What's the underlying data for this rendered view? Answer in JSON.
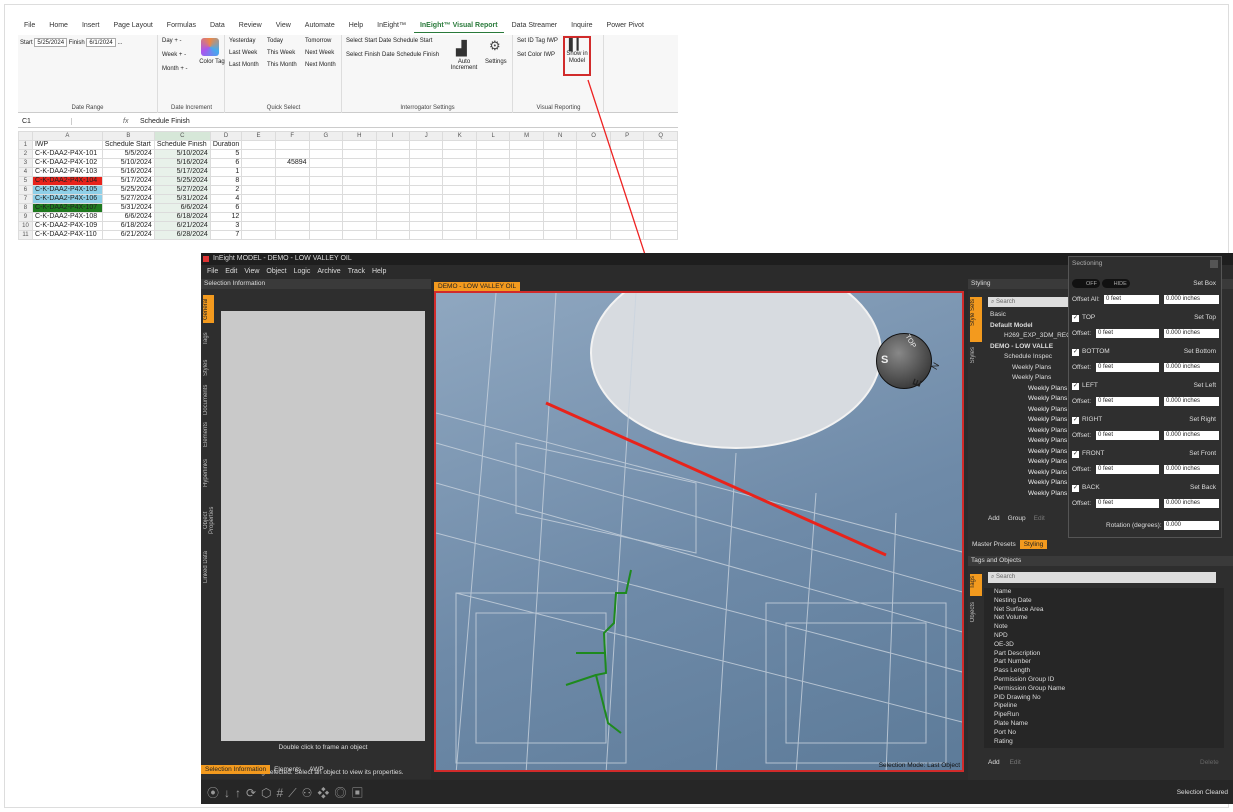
{
  "excel": {
    "menu": [
      "File",
      "Home",
      "Insert",
      "Page Layout",
      "Formulas",
      "Data",
      "Review",
      "View",
      "Automate",
      "Help",
      "InEight™",
      "InEight™ Visual Report",
      "Data Streamer",
      "Inquire",
      "Power Pivot"
    ],
    "active_menu": "InEight™ Visual Report",
    "ribbon": {
      "start_label": "Start",
      "start_value": "5/25/2024",
      "finish_label": "Finish",
      "finish_value": "6/1/2024",
      "dots": "...",
      "date_range_title": "Date Range",
      "day": "Day + -",
      "week": "Week + -",
      "month": "Month + -",
      "color_tag": "Color Tag",
      "date_increment_title": "Date Increment",
      "quick": [
        "Yesterday",
        "Today",
        "Tomorrow",
        "Last Week",
        "This Week",
        "Next Week",
        "Last Month",
        "This Month",
        "Next Month"
      ],
      "quick_select_title": "Quick Select",
      "sel_start_date": "Select Start Date",
      "sched_start": "Schedule Start",
      "sel_finish_date": "Select Finish Date",
      "sched_finish": "Schedule Finish",
      "auto_increment": "Auto Increment",
      "settings": "Settings",
      "interrogator_title": "Interrogator Settings",
      "set_id_tag": "Set ID Tag",
      "iwp1": "IWP",
      "set_color": "Set Color",
      "iwp2": "IWP",
      "show_in_model": "Show in Model",
      "visual_reporting_title": "Visual Reporting"
    },
    "formula": {
      "cell": "C1",
      "fx": "fx",
      "content": "Schedule Finish"
    },
    "col_headers": [
      "A",
      "B",
      "C",
      "D",
      "E",
      "F",
      "G",
      "H",
      "I",
      "J",
      "K",
      "L",
      "M",
      "N",
      "O",
      "P",
      "Q"
    ],
    "rows": [
      [
        "IWP",
        "Schedule Start",
        "Schedule Finish",
        "Duration",
        ""
      ],
      [
        "C-K-DAA2-P4X-101",
        "5/5/2024",
        "5/10/2024",
        "5",
        ""
      ],
      [
        "C-K-DAA2-P4X-102",
        "5/10/2024",
        "5/16/2024",
        "6",
        "45894"
      ],
      [
        "C-K-DAA2-P4X-103",
        "5/16/2024",
        "5/17/2024",
        "1",
        ""
      ],
      [
        "C-K-DAA2-P4X-104",
        "5/17/2024",
        "5/25/2024",
        "8",
        ""
      ],
      [
        "C-K-DAA2-P4X-105",
        "5/25/2024",
        "5/27/2024",
        "2",
        ""
      ],
      [
        "C-K-DAA2-P4X-106",
        "5/27/2024",
        "5/31/2024",
        "4",
        ""
      ],
      [
        "C-K-DAA2-P4X-107",
        "5/31/2024",
        "6/6/2024",
        "6",
        ""
      ],
      [
        "C-K-DAA2-P4X-108",
        "6/6/2024",
        "6/18/2024",
        "12",
        ""
      ],
      [
        "C-K-DAA2-P4X-109",
        "6/18/2024",
        "6/21/2024",
        "3",
        ""
      ],
      [
        "C-K-DAA2-P4X-110",
        "6/21/2024",
        "6/28/2024",
        "7",
        ""
      ]
    ],
    "row_colors": {
      "5": "#e8231b",
      "6": "#8fd0e8",
      "7": "#8fd0e8",
      "8": "#1f7a1f"
    }
  },
  "app": {
    "title": "InEight MODEL - DEMO - LOW VALLEY OIL",
    "menu": [
      "File",
      "Edit",
      "View",
      "Object",
      "Logic",
      "Archive",
      "Track",
      "Help"
    ],
    "selection_info": "Selection Information",
    "vtabs": [
      "General",
      "Tags",
      "Styles",
      "Documents",
      "Elements",
      "Hyperlinks",
      "Object Properties",
      "Linked Data"
    ],
    "double_click": "Double click to frame an object",
    "nothing_selected": "Nothing selected. Select an object to view its properties.",
    "bottom_tabs": [
      "Selection Information",
      "Elements",
      "AWP"
    ],
    "viewport_tab": "DEMO - LOW VALLEY OIL",
    "selection_mode": "Selection Mode: Last Object",
    "status": "Selection Cleared",
    "styling": {
      "title": "Styling",
      "search": "Search",
      "vtabs": [
        "Style Sets",
        "Styles"
      ],
      "items": [
        "Basic",
        "Default Model",
        "H269_EXP_3DM_REC",
        "DEMO - LOW VALLE",
        "Schedule Inspec",
        "Weekly Plans",
        "Weekly Plans",
        "Weekly Plans",
        "Weekly Plans",
        "Weekly Plans",
        "Weekly Plans",
        "Weekly Plans",
        "Weekly Plans",
        "Weekly Plans",
        "Weekly Plans",
        "Weekly Plans",
        "Weekly Plans",
        "Weekly Plans"
      ],
      "add": "Add",
      "group": "Group",
      "edit": "Edit",
      "tabs": [
        "Master Presets",
        "Styling"
      ]
    },
    "tags": {
      "title": "Tags and Objects",
      "search": "Search",
      "vtabs": [
        "Tags",
        "Objects"
      ],
      "items": [
        "Name",
        "Nesting Date",
        "Net Surface Area",
        "Net Volume",
        "Note",
        "NPD",
        "OE-3D",
        "Part Description",
        "Part Number",
        "Pass Length",
        "Permission Group ID",
        "Permission Group Name",
        "PID Drawing No",
        "Pipeline",
        "PipeRun",
        "Plate Name",
        "Port No",
        "Rating"
      ],
      "add": "Add",
      "edit": "Edit",
      "delete": "Delete"
    },
    "sectioning": {
      "title": "Sectioning",
      "off": "OFF",
      "hide": "HIDE",
      "set_box": "Set Box",
      "offset_all": "Offset All:",
      "feet": "0 feet",
      "inches": "0.000 inches",
      "sides": [
        {
          "name": "TOP",
          "btn": "Set Top"
        },
        {
          "name": "BOTTOM",
          "btn": "Set Bottom"
        },
        {
          "name": "LEFT",
          "btn": "Set Left"
        },
        {
          "name": "RIGHT",
          "btn": "Set Right"
        },
        {
          "name": "FRONT",
          "btn": "Set Front"
        },
        {
          "name": "BACK",
          "btn": "Set Back"
        }
      ],
      "offset": "Offset:",
      "rotation_label": "Rotation (degrees):",
      "rotation": "0.000"
    },
    "compass": {
      "top": "TOP",
      "s": "S",
      "e": "E",
      "n": "N"
    }
  }
}
